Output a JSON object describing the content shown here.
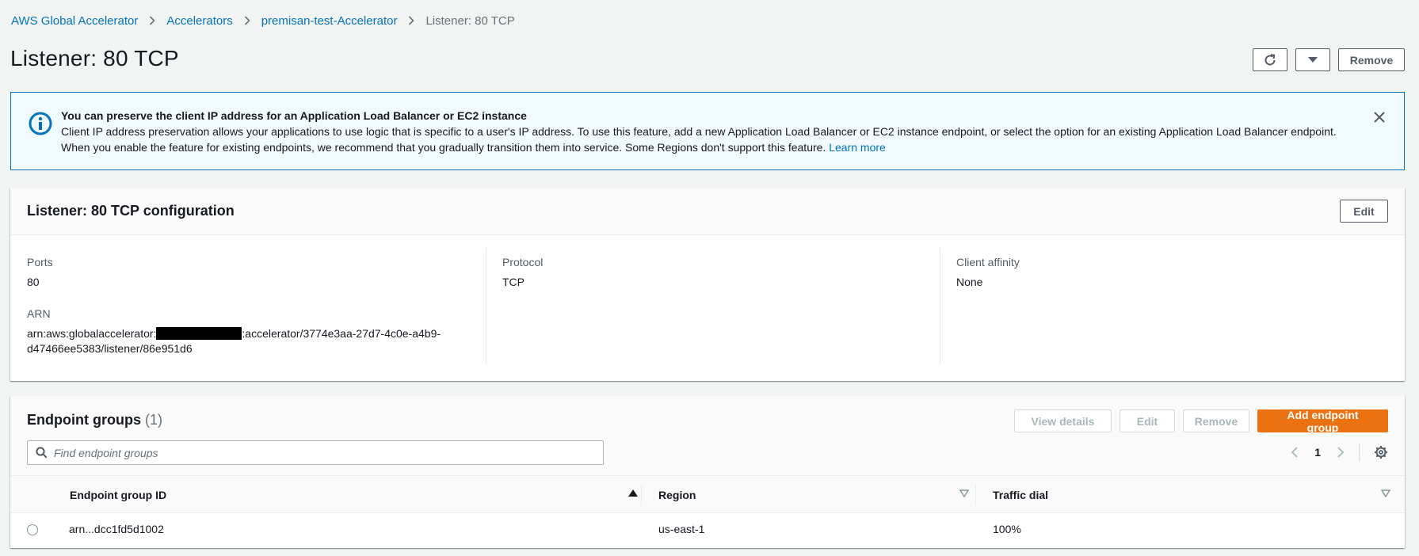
{
  "breadcrumbs": [
    {
      "label": "AWS Global Accelerator"
    },
    {
      "label": "Accelerators"
    },
    {
      "label": "premisan-test-Accelerator"
    },
    {
      "label": "Listener: 80 TCP"
    }
  ],
  "page": {
    "title": "Listener: 80 TCP",
    "remove_label": "Remove"
  },
  "flash": {
    "title": "You can preserve the client IP address for an Application Load Balancer or EC2 instance",
    "body": "Client IP address preservation allows your applications to use logic that is specific to a user's IP address. To use this feature, add a new Application Load Balancer or EC2 instance endpoint, or select the option for an existing Application Load Balancer endpoint. When you enable the feature for existing endpoints, we recommend that you gradually transition them into service. Some Regions don't support this feature.",
    "link": "Learn more"
  },
  "config": {
    "title": "Listener: 80 TCP configuration",
    "edit_label": "Edit",
    "ports_label": "Ports",
    "ports_value": "80",
    "arn_label": "ARN",
    "arn_prefix": "arn:aws:globalaccelerator:",
    "arn_suffix": ":accelerator/3774e3aa-27d7-4c0e-a4b9-",
    "arn_line2": "d47466ee5383/listener/86e951d6",
    "protocol_label": "Protocol",
    "protocol_value": "TCP",
    "affinity_label": "Client affinity",
    "affinity_value": "None"
  },
  "endpoint_groups": {
    "title": "Endpoint groups",
    "count": "(1)",
    "view_details_label": "View details",
    "edit_label": "Edit",
    "remove_label": "Remove",
    "add_label": "Add endpoint group",
    "search_placeholder": "Find endpoint groups",
    "page_number": "1",
    "columns": {
      "id": "Endpoint group ID",
      "region": "Region",
      "traffic": "Traffic dial"
    },
    "rows": [
      {
        "id": "arn...dcc1fd5d1002",
        "region": "us-east-1",
        "traffic": "100%"
      }
    ]
  },
  "colors": {
    "link": "#0073bb",
    "primary": "#ec7211",
    "info_bg": "#f1faff",
    "page_bg": "#f2f3f3"
  }
}
